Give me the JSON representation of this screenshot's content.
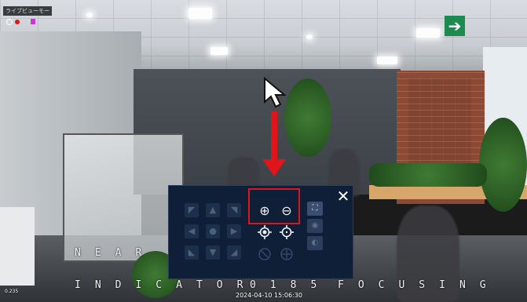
{
  "window": {
    "title": "ライブビューモード"
  },
  "overlay": {
    "near_label": "NEAR",
    "indicator_label": "INDICATOR",
    "indicator_value": "0185",
    "focusing_label": "FOCUSING",
    "timestamp": "2024-04-10 15:06:30",
    "left_corner": "0.235"
  },
  "ptz": {
    "directions": [
      "up-left",
      "up",
      "up-right",
      "left",
      "center",
      "right",
      "down-left",
      "down",
      "down-right"
    ],
    "zoom_in_symbol": "⊕",
    "zoom_out_symbol": "⊖",
    "close_symbol": "✕",
    "fit_symbol": "⛶"
  },
  "annotation": {
    "highlight_color": "#e0141b"
  },
  "scene": {
    "exit_sign": "➔"
  }
}
